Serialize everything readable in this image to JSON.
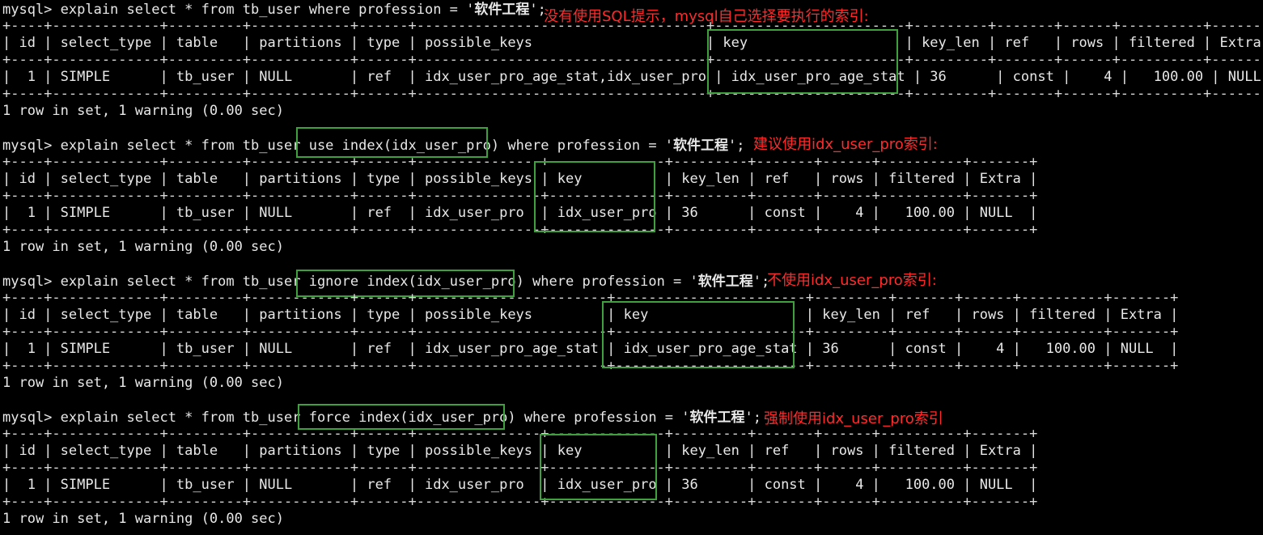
{
  "block1": {
    "prompt": "mysql> explain select * from tb_user where profession = '",
    "value": "软件工程",
    "tail": "';",
    "note": "没有使用SQL提示，mysql自己选择要执行的索引:",
    "border": "+----+-------------+---------+------------+------+-----------------------------------+-----------------------+---------+-------+------+----------+-------+",
    "header": "| id | select_type | table   | partitions | type | possible_keys                     | key                   | key_len | ref   | rows | filtered | Extra |",
    "row": "|  1 | SIMPLE      | tb_user | NULL       | ref  | idx_user_pro_age_stat,idx_user_pro | idx_user_pro_age_stat | 36      | const |    4 |   100.00 | NULL  |",
    "footer": "1 row in set, 1 warning (0.00 sec)"
  },
  "block2": {
    "prompt_a": "mysql> explain select * from tb_user ",
    "hint": "use index(idx_user_pro)",
    "prompt_b": " where profession = '",
    "value": "软件工程",
    "tail": "';",
    "note": "建议使用idx_user_pro索引:",
    "border": "+----+-------------+---------+------------+------+---------------+--------------+---------+-------+------+----------+-------+",
    "header": "| id | select_type | table   | partitions | type | possible_keys | key          | key_len | ref   | rows | filtered | Extra |",
    "row": "|  1 | SIMPLE      | tb_user | NULL       | ref  | idx_user_pro  | idx_user_pro | 36      | const |    4 |   100.00 | NULL  |",
    "footer": "1 row in set, 1 warning (0.00 sec)"
  },
  "block3": {
    "prompt_a": "mysql> explain select * from tb_user ",
    "hint": "ignore index(idx_user_pro)",
    "prompt_b": " where profession = '",
    "value": "软件工程",
    "tail": "';",
    "note": "不使用idx_user_pro索引:",
    "border": "+----+-------------+---------+------------+------+-----------------------+-----------------------+---------+-------+------+----------+-------+",
    "header": "| id | select_type | table   | partitions | type | possible_keys         | key                   | key_len | ref   | rows | filtered | Extra |",
    "row": "|  1 | SIMPLE      | tb_user | NULL       | ref  | idx_user_pro_age_stat | idx_user_pro_age_stat | 36      | const |    4 |   100.00 | NULL  |",
    "footer": "1 row in set, 1 warning (0.00 sec)"
  },
  "block4": {
    "prompt_a": "mysql> explain select * from tb_user ",
    "hint": "force index(idx_user_pro)",
    "prompt_b": " where profession = '",
    "value": "软件工程",
    "tail": "';",
    "note": "强制使用idx_user_pro索引",
    "border": "+----+-------------+---------+------------+------+---------------+--------------+---------+-------+------+----------+-------+",
    "header": "| id | select_type | table   | partitions | type | possible_keys | key          | key_len | ref   | rows | filtered | Extra |",
    "row": "|  1 | SIMPLE      | tb_user | NULL       | ref  | idx_user_pro  | idx_user_pro | 36      | const |    4 |   100.00 | NULL  |",
    "footer": "1 row in set, 1 warning (0.00 sec)"
  },
  "colors": {
    "background": "#000000",
    "text": "#e8e8e8",
    "annotation": "#ff2a2a",
    "highlight": "#3ea13e"
  }
}
